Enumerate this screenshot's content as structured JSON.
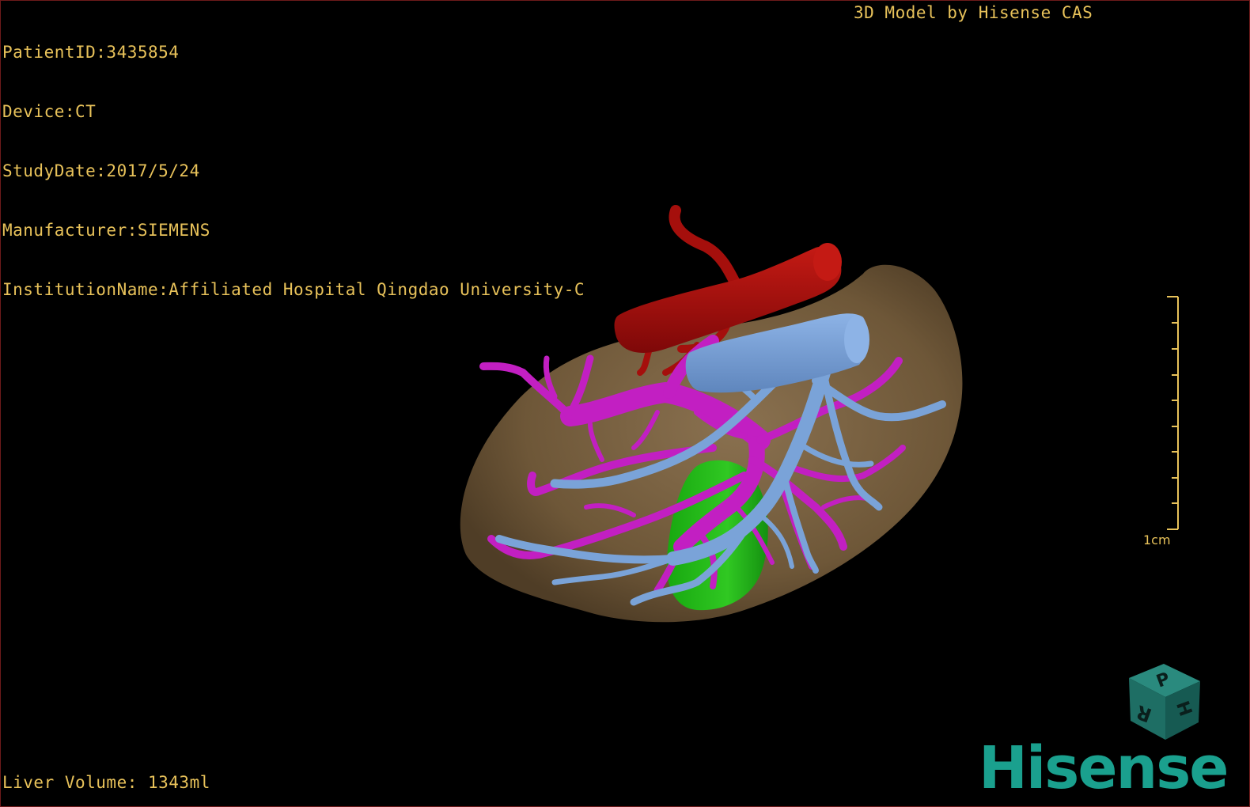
{
  "overlay": {
    "patient_id": "PatientID:3435854",
    "device": "Device:CT",
    "study_date": "StudyDate:2017/5/24",
    "manufacturer": "Manufacturer:SIEMENS",
    "institution": "InstitutionName:Affiliated Hospital Qingdao University-C",
    "credit": "3D Model by Hisense CAS",
    "liver_volume": "Liver Volume: 1343ml"
  },
  "scale": {
    "label": "1cm"
  },
  "orientation_cube": {
    "face_top": "P",
    "face_front": "R",
    "face_side": "H"
  },
  "logo": {
    "text": "Hisense"
  },
  "colors": {
    "text": "#e8c25a",
    "liver": "#7a6242",
    "hepatic_artery_aorta": "#b3100e",
    "portal_vein": "#c21fc2",
    "hepatic_vein_ivc": "#7aa3d8",
    "tumor": "#22b418",
    "logo": "#1aa08e"
  }
}
